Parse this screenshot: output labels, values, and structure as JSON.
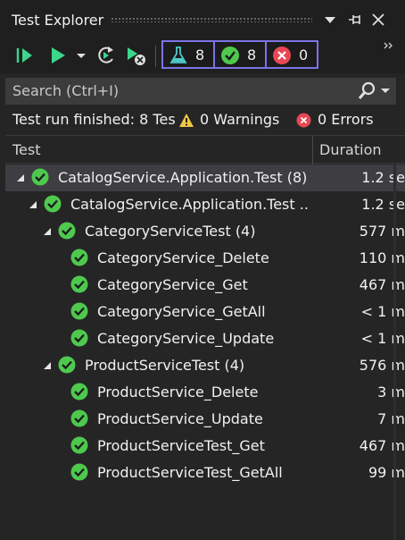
{
  "window": {
    "title": "Test Explorer"
  },
  "toolbar": {
    "counters": {
      "total": "8",
      "passed": "8",
      "failed": "0"
    },
    "colors": {
      "accent": "#7b74e6",
      "run_green": "#3dd68c",
      "pass_green": "#4ec94e",
      "fail_red": "#e84855",
      "warn_yellow": "#f2c744"
    }
  },
  "search": {
    "placeholder": "Search (Ctrl+I)"
  },
  "status": {
    "run_text": "Test run finished: 8 Tes",
    "warnings": "0 Warnings",
    "errors": "0 Errors"
  },
  "columns": {
    "test": "Test",
    "duration": "Duration"
  },
  "tree": [
    {
      "label": "CatalogService.Application.Test  (8)",
      "duration": "1.2 se",
      "level": 0,
      "expanded": true,
      "selected": true
    },
    {
      "label": "CatalogService.Application.Test  ..",
      "duration": "1.2 se",
      "level": 1,
      "expanded": true,
      "selected": false
    },
    {
      "label": "CategoryServiceTest  (4)",
      "duration": "577 m",
      "level": 2,
      "expanded": true,
      "selected": false
    },
    {
      "label": "CategoryService_Delete",
      "duration": "110 m",
      "level": 3,
      "expanded": false,
      "selected": false
    },
    {
      "label": "CategoryService_Get",
      "duration": "467 m",
      "level": 3,
      "expanded": false,
      "selected": false
    },
    {
      "label": "CategoryService_GetAll",
      "duration": "< 1 m",
      "level": 3,
      "expanded": false,
      "selected": false
    },
    {
      "label": "CategoryService_Update",
      "duration": "< 1 m",
      "level": 3,
      "expanded": false,
      "selected": false
    },
    {
      "label": "ProductServiceTest  (4)",
      "duration": "576 m",
      "level": 2,
      "expanded": true,
      "selected": false
    },
    {
      "label": "ProductService_Delete",
      "duration": "3 m",
      "level": 3,
      "expanded": false,
      "selected": false
    },
    {
      "label": "ProductService_Update",
      "duration": "7 m",
      "level": 3,
      "expanded": false,
      "selected": false
    },
    {
      "label": "ProductServiceTest_Get",
      "duration": "467 m",
      "level": 3,
      "expanded": false,
      "selected": false
    },
    {
      "label": "ProductServiceTest_GetAll",
      "duration": "99 m",
      "level": 3,
      "expanded": false,
      "selected": false
    }
  ]
}
